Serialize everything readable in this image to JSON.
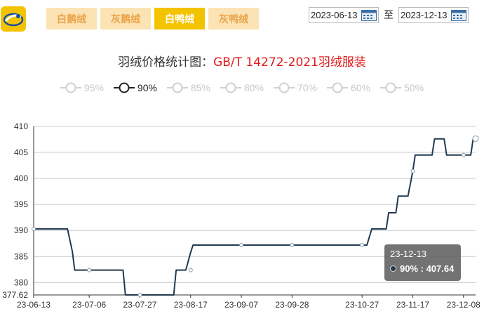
{
  "tabs": [
    {
      "label": "白鹅绒",
      "active": false
    },
    {
      "label": "灰鹅绒",
      "active": false
    },
    {
      "label": "白鸭绒",
      "active": true
    },
    {
      "label": "灰鸭绒",
      "active": false
    }
  ],
  "date_range": {
    "start": "2023-06-13",
    "separator": "至",
    "end": "2023-12-13"
  },
  "title": {
    "prefix": "羽绒价格统计图：",
    "standard": "GB/T 14272-2021羽绒服装"
  },
  "legend": [
    {
      "label": "95%",
      "active": false
    },
    {
      "label": "90%",
      "active": true
    },
    {
      "label": "85%",
      "active": false
    },
    {
      "label": "80%",
      "active": false
    },
    {
      "label": "70%",
      "active": false
    },
    {
      "label": "60%",
      "active": false
    },
    {
      "label": "50%",
      "active": false
    }
  ],
  "tooltip": {
    "date": "23-12-13",
    "text": "90% : 407.64"
  },
  "colors": {
    "accent": "#f4c300",
    "tab_inactive_bg": "#fce3b4",
    "tab_inactive_text": "#e9a44b",
    "series": "#233a4f",
    "standard_text": "#e3191b"
  },
  "chart_data": {
    "type": "line",
    "title": "羽绒价格统计图：GB/T 14272-2021羽绒服装",
    "x_tick_labels": [
      "23-06-13",
      "23-07-06",
      "23-07-27",
      "23-08-17",
      "23-09-07",
      "23-09-28",
      "23-10-27",
      "23-11-17",
      "23-12-08"
    ],
    "y_ticks": [
      377.62,
      380,
      385,
      390,
      395,
      400,
      405,
      410
    ],
    "ylim": [
      377.62,
      410
    ],
    "xlim": [
      "2023-06-13",
      "2023-12-13"
    ],
    "grid": true,
    "series": [
      {
        "name": "90%",
        "points": [
          {
            "x": "2023-06-13",
            "y": 390.3
          },
          {
            "x": "2023-06-27",
            "y": 390.3
          },
          {
            "x": "2023-06-29",
            "y": 386.0
          },
          {
            "x": "2023-06-30",
            "y": 382.4
          },
          {
            "x": "2023-07-20",
            "y": 382.4
          },
          {
            "x": "2023-07-21",
            "y": 377.62
          },
          {
            "x": "2023-08-10",
            "y": 377.62
          },
          {
            "x": "2023-08-11",
            "y": 382.4
          },
          {
            "x": "2023-08-15",
            "y": 382.4
          },
          {
            "x": "2023-08-17",
            "y": 385.8
          },
          {
            "x": "2023-08-18",
            "y": 387.2
          },
          {
            "x": "2023-10-29",
            "y": 387.2
          },
          {
            "x": "2023-10-31",
            "y": 390.3
          },
          {
            "x": "2023-11-06",
            "y": 390.3
          },
          {
            "x": "2023-11-07",
            "y": 393.4
          },
          {
            "x": "2023-11-10",
            "y": 393.4
          },
          {
            "x": "2023-11-11",
            "y": 396.6
          },
          {
            "x": "2023-11-15",
            "y": 396.6
          },
          {
            "x": "2023-11-17",
            "y": 401.4
          },
          {
            "x": "2023-11-18",
            "y": 404.5
          },
          {
            "x": "2023-11-25",
            "y": 404.5
          },
          {
            "x": "2023-11-26",
            "y": 407.6
          },
          {
            "x": "2023-11-30",
            "y": 407.6
          },
          {
            "x": "2023-12-01",
            "y": 404.5
          },
          {
            "x": "2023-12-07",
            "y": 404.5
          },
          {
            "x": "2023-12-08",
            "y": 404.5
          },
          {
            "x": "2023-12-09",
            "y": 404.5
          },
          {
            "x": "2023-12-10",
            "y": 404.5
          },
          {
            "x": "2023-12-11",
            "y": 404.5
          },
          {
            "x": "2023-12-12",
            "y": 407.64
          },
          {
            "x": "2023-12-13",
            "y": 407.64
          }
        ],
        "markers": [
          {
            "x": "2023-06-13",
            "y": 390.3
          },
          {
            "x": "2023-07-06",
            "y": 382.4
          },
          {
            "x": "2023-07-27",
            "y": 377.62
          },
          {
            "x": "2023-08-17",
            "y": 382.4
          },
          {
            "x": "2023-09-07",
            "y": 387.2
          },
          {
            "x": "2023-09-28",
            "y": 387.2
          },
          {
            "x": "2023-10-27",
            "y": 387.2
          },
          {
            "x": "2023-11-17",
            "y": 401.4
          },
          {
            "x": "2023-12-08",
            "y": 404.5
          },
          {
            "x": "2023-12-13",
            "y": 407.64
          }
        ]
      }
    ]
  }
}
